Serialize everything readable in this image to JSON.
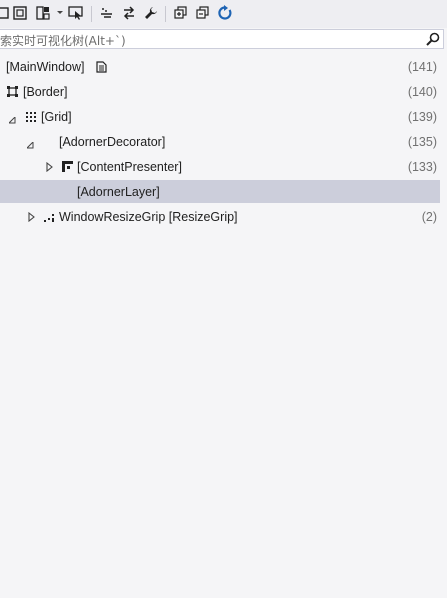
{
  "search": {
    "placeholder": "搜索实时可视化树(Alt+`)"
  },
  "tree": {
    "items": [
      {
        "label": "[MainWindow]",
        "count": "(141)"
      },
      {
        "label": "[Border]",
        "count": "(140)"
      },
      {
        "label": "[Grid]",
        "count": "(139)"
      },
      {
        "label": "[AdornerDecorator]",
        "count": "(135)"
      },
      {
        "label": "[ContentPresenter]",
        "count": "(133)"
      },
      {
        "label": "[AdornerLayer]",
        "count": ""
      },
      {
        "label": "WindowResizeGrip [ResizeGrip]",
        "count": "(2)"
      }
    ]
  },
  "colors": {
    "selection": "#cccedb",
    "accent": "#1e64b4"
  }
}
